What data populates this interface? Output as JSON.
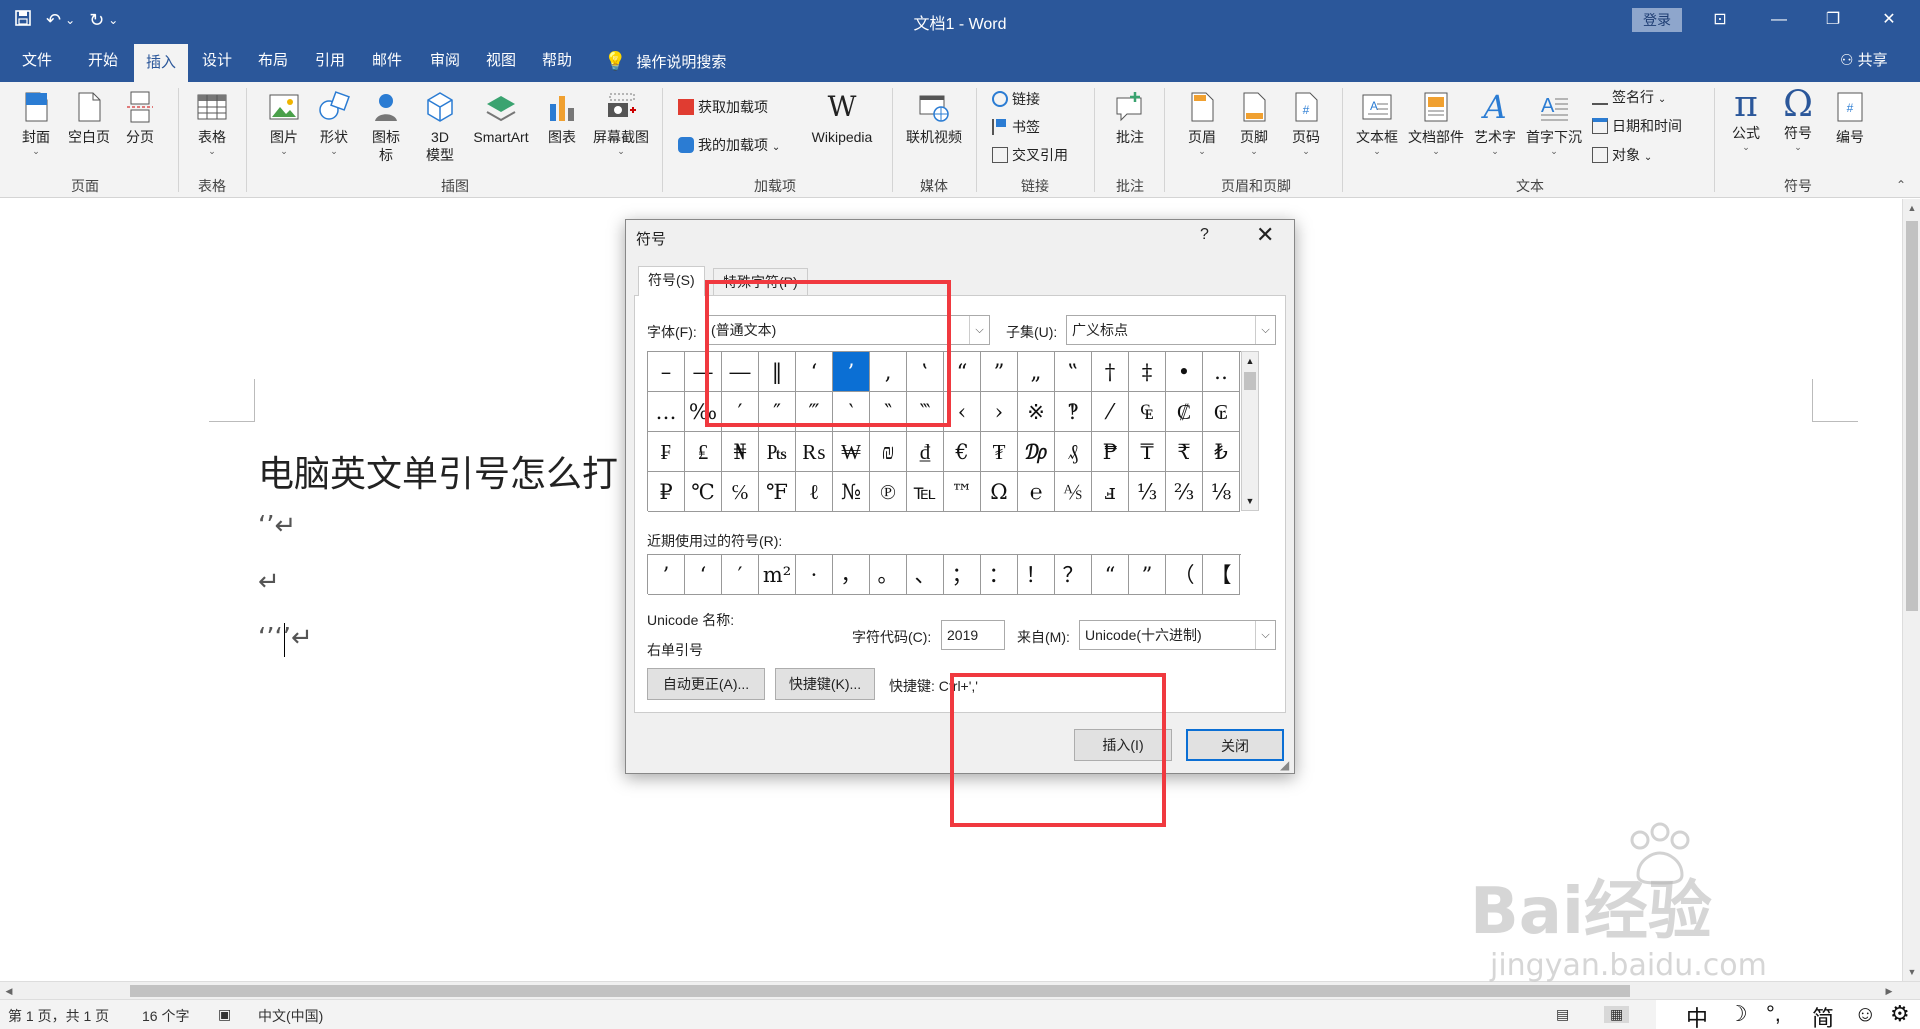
{
  "window": {
    "title": "文档1 - Word",
    "login_label": "登录",
    "share_label": "共享"
  },
  "menu": {
    "tabs": [
      "文件",
      "开始",
      "插入",
      "设计",
      "布局",
      "引用",
      "邮件",
      "审阅",
      "视图",
      "帮助"
    ],
    "active_tab": "插入",
    "search_hint": "操作说明搜索"
  },
  "ribbon": {
    "page": {
      "cover": "封面",
      "blank": "空白页",
      "break": "分页",
      "group": "页面"
    },
    "table": {
      "table": "表格",
      "group": "表格"
    },
    "illustrations": {
      "picture": "图片",
      "shapes": "形状",
      "icons": "图标",
      "icons2": "标",
      "model3d": "3D",
      "model3d2": "模型",
      "smartart": "SmartArt",
      "chart": "图表",
      "screenshot": "屏幕截图",
      "group": "插图"
    },
    "addins": {
      "get": "获取加载项",
      "my": "我的加载项",
      "wikipedia": "Wikipedia",
      "group": "加载项"
    },
    "media": {
      "video": "联机视频",
      "group": "媒体"
    },
    "links": {
      "link": "链接",
      "bookmark": "书签",
      "crossref": "交叉引用",
      "group": "链接"
    },
    "comments": {
      "comment": "批注",
      "group": "批注"
    },
    "headerfooter": {
      "header": "页眉",
      "footer": "页脚",
      "pagenum": "页码",
      "group": "页眉和页脚"
    },
    "text": {
      "textbox": "文本框",
      "parts": "文档部件",
      "wordart": "艺术字",
      "dropcap": "首字下沉",
      "signature": "签名行",
      "datetime": "日期和时间",
      "object": "对象",
      "group": "文本"
    },
    "symbols": {
      "equation": "公式",
      "symbol": "符号",
      "number": "编号",
      "group": "符号"
    }
  },
  "document": {
    "heading": "电脑英文单引号怎么打",
    "line1": "‘’↵",
    "line2": "↵",
    "line3": "‘’‘’↵"
  },
  "dialog": {
    "title": "符号",
    "help": "?",
    "tab_symbols": "符号(S)",
    "tab_special": "特殊字符(P)",
    "font_label": "字体(F):",
    "font_value": "(普通文本)",
    "subset_label": "子集(U):",
    "subset_value": "广义标点",
    "symbols": [
      [
        "–",
        "—",
        "―",
        "‖",
        "‘",
        "’",
        "‚",
        "‛",
        "“",
        "”",
        "„",
        "‟",
        "†",
        "‡",
        "•",
        "‥"
      ],
      [
        "…",
        "‰",
        "′",
        "″",
        "‴",
        "‵",
        "‶",
        "‷",
        "‹",
        "›",
        "※",
        "‽",
        "⁄",
        "₠",
        "₡",
        "₢"
      ],
      [
        "₣",
        "₤",
        "₦",
        "₧",
        "₨",
        "₩",
        "₪",
        "₫",
        "€",
        "₮",
        "₯",
        "₰",
        "₱",
        "₸",
        "₹",
        "₺"
      ],
      [
        "₽",
        "℃",
        "℅",
        "℉",
        "ℓ",
        "№",
        "℗",
        "℡",
        "™",
        "Ω",
        "℮",
        "⅍",
        "ⅎ",
        "⅓",
        "⅔",
        "⅛"
      ]
    ],
    "selected_symbol": "’",
    "recent_label": "近期使用过的符号(R):",
    "recent": [
      "’",
      "‘",
      "′",
      "m²",
      "·",
      "，",
      "。",
      "、",
      "；",
      "：",
      "！",
      "？",
      "“",
      "”",
      "（",
      "【"
    ],
    "unicode_name_label": "Unicode 名称:",
    "unicode_name_value": "右单引号",
    "charcode_label": "字符代码(C):",
    "charcode_value": "2019",
    "from_label": "来自(M):",
    "from_value": "Unicode(十六进制)",
    "autocorrect_btn": "自动更正(A)...",
    "shortcut_btn": "快捷键(K)...",
    "shortcut_text": "快捷键: Ctrl+','",
    "insert_btn": "插入(I)",
    "close_btn": "关闭"
  },
  "status": {
    "page": "第 1 页，共 1 页",
    "words": "16 个字",
    "language": "中文(中国)",
    "ime": [
      "中",
      "☽",
      "°,",
      "简",
      "☺",
      "⚙"
    ]
  },
  "watermark": {
    "brand": "Bai经验",
    "url": "jingyan.baidu.com"
  },
  "colors": {
    "word_blue": "#2b579a",
    "highlight": "#f0393f",
    "selection": "#0b6fd4"
  }
}
